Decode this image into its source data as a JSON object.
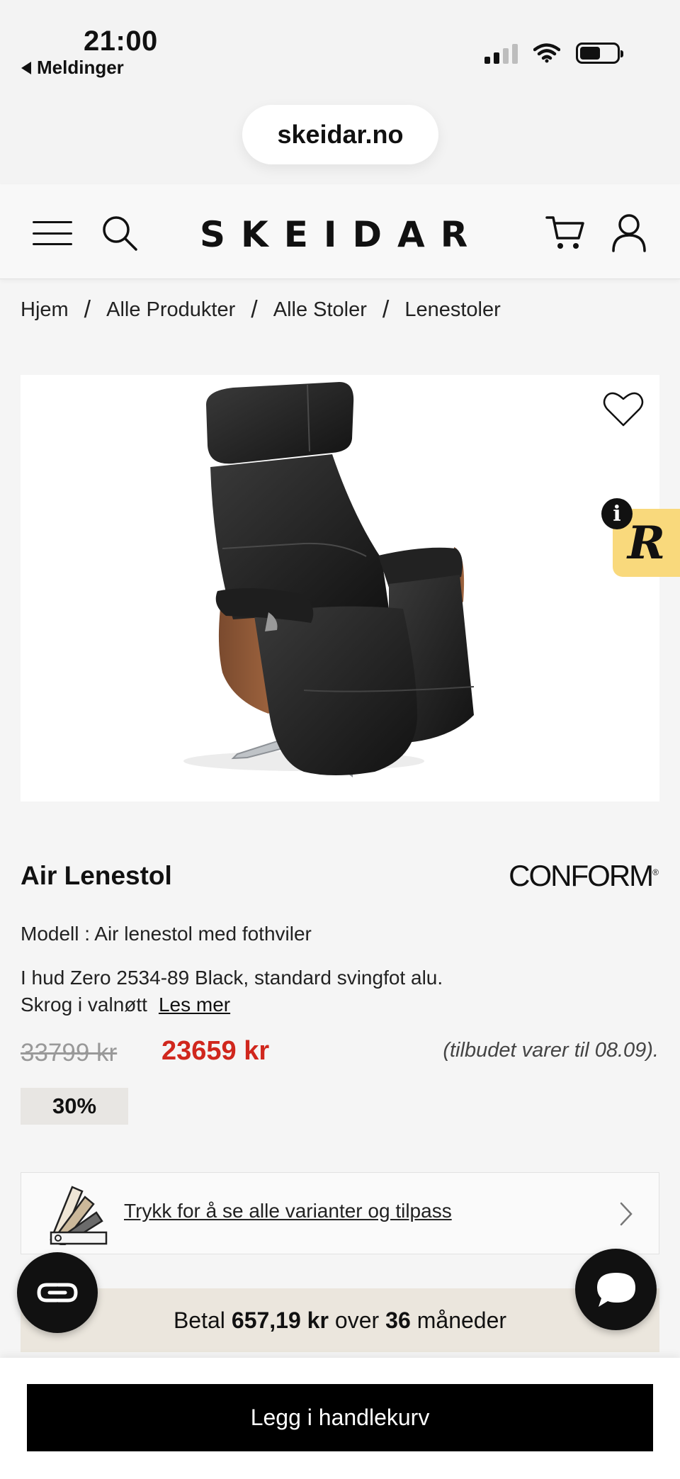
{
  "status_bar": {
    "time": "21:00",
    "back_app": "Meldinger"
  },
  "browser": {
    "url": "skeidar.no"
  },
  "header": {
    "logo": "SKEIDAR"
  },
  "breadcrumb": [
    "Hjem",
    "Alle Produkter",
    "Alle Stoler",
    "Lenestoler"
  ],
  "product": {
    "title": "Air Lenestol",
    "brand": "CONFORM",
    "brand_mark": "®",
    "model": "Modell : Air lenestol med fothviler",
    "description_line1": "I hud Zero 2534-89 Black, standard svingfot alu.",
    "description_line2": "Skrog i valnøtt",
    "read_more": "Les mer",
    "old_price": "33799 kr",
    "new_price": "23659 kr",
    "offer_note": "(tilbudet varer til 08.09).",
    "discount": "30%"
  },
  "badges": {
    "info": "i",
    "r_badge": "R"
  },
  "variants": {
    "label": "Trykk for å se alle varianter og tilpass"
  },
  "payment": {
    "prefix": "Betal",
    "amount": "657,19 kr",
    "middle": "over",
    "months": "36",
    "suffix": "måneder"
  },
  "cart": {
    "button_label": "Legg i handlekurv"
  },
  "colors": {
    "sale_red": "#d0271d",
    "badge_yellow": "#f9d97c",
    "pay_banner_bg": "#ebe6dd"
  },
  "icons": [
    "menu-icon",
    "search-icon",
    "cart-icon",
    "user-icon",
    "heart-icon",
    "chevron-right-icon",
    "chat-icon",
    "cobrowse-icon",
    "swatch-fan-icon"
  ]
}
